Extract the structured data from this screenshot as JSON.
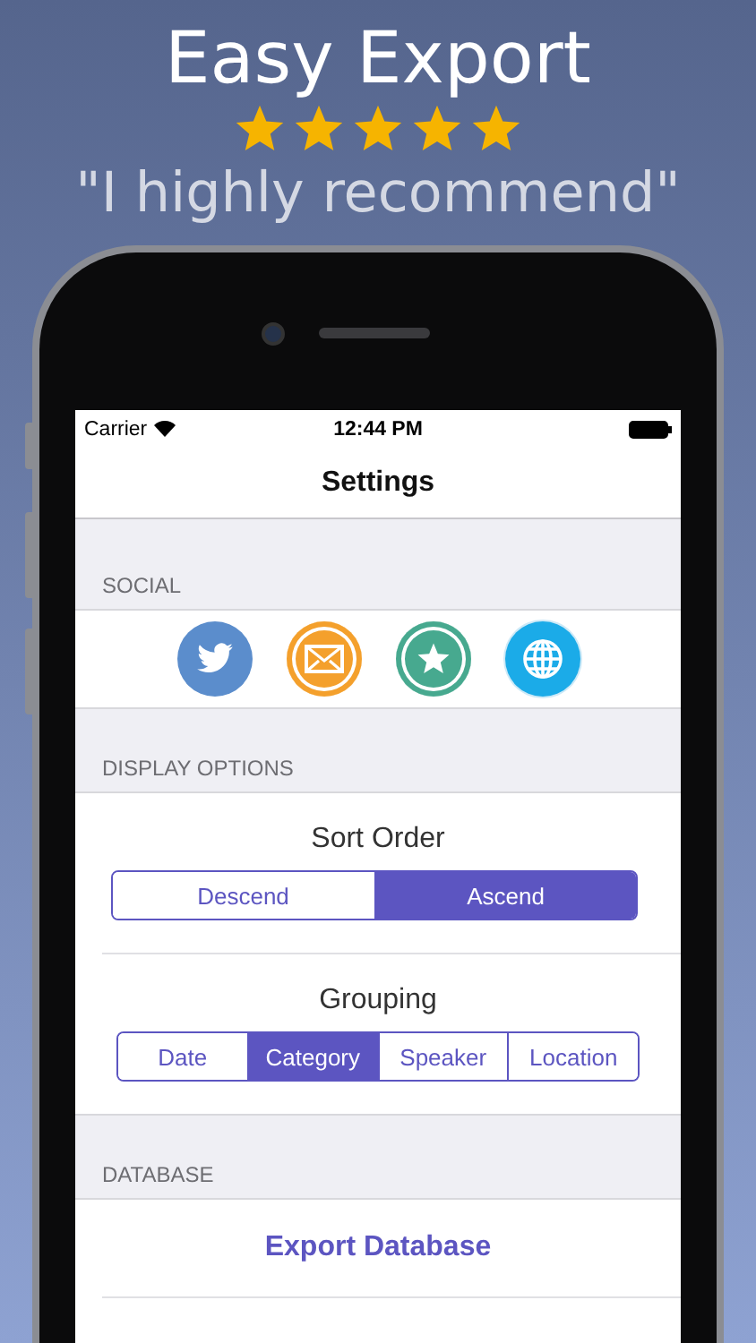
{
  "promo": {
    "headline": "Easy Export",
    "stars": 5,
    "quote": "\"I highly recommend\""
  },
  "status_bar": {
    "carrier": "Carrier",
    "time": "12:44 PM"
  },
  "nav": {
    "title": "Settings"
  },
  "sections": [
    {
      "kind": "social",
      "header": "SOCIAL",
      "icons": [
        {
          "kind": "bird",
          "color": "#5b8dcc"
        },
        {
          "kind": "mail",
          "color": "#f4a02c"
        },
        {
          "kind": "star",
          "color": "#47a98f"
        },
        {
          "kind": "globe",
          "color": "#1babe8"
        }
      ]
    },
    {
      "kind": "options",
      "header": "DISPLAY OPTIONS",
      "groups": [
        {
          "title": "Sort Order",
          "segments": [
            {
              "label": "Descend",
              "selected": false
            },
            {
              "label": "Ascend",
              "selected": true
            }
          ]
        },
        {
          "title": "Grouping",
          "segments": [
            {
              "label": "Date",
              "selected": false
            },
            {
              "label": "Category",
              "selected": true
            },
            {
              "label": "Speaker",
              "selected": false
            },
            {
              "label": "Location",
              "selected": false
            }
          ]
        }
      ]
    },
    {
      "kind": "actions",
      "header": "DATABASE",
      "actions": [
        {
          "label": "Export Database"
        }
      ]
    }
  ]
}
